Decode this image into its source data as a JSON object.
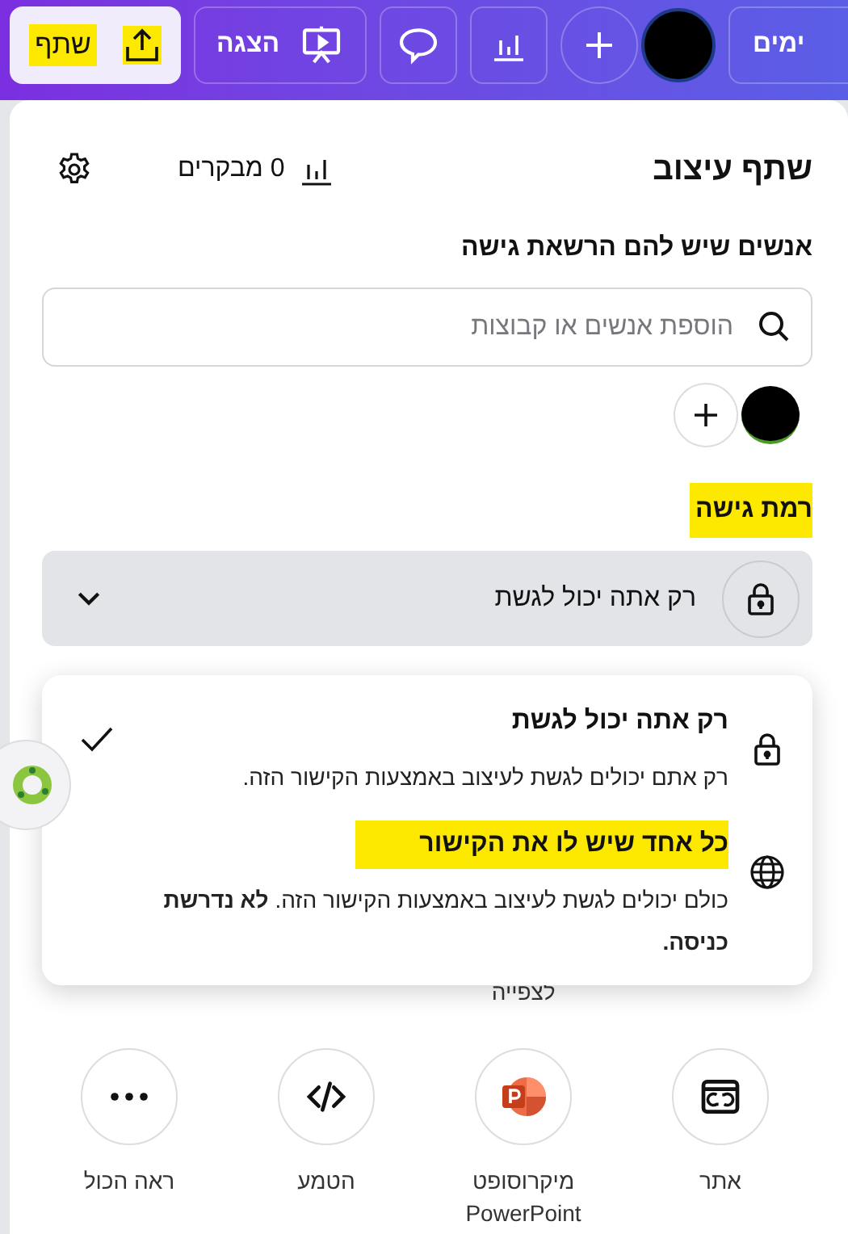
{
  "top_bar": {
    "share_button": {
      "label": "שתף",
      "highlighted": true
    },
    "present_button": {
      "label": "הצגה"
    },
    "days_button": {
      "label": "ימים"
    }
  },
  "panel": {
    "title": "שתף עיצוב",
    "visitors": "0 מבקרים"
  },
  "people": {
    "heading": "אנשים שיש להם הרשאת גישה",
    "search": {
      "placeholder": "הוספת אנשים או קבוצות"
    }
  },
  "access": {
    "heading": "רמת גישה",
    "highlighted": true,
    "current": "רק אתה יכול לגשת",
    "options": [
      {
        "kind": "private",
        "title": "רק אתה יכול לגשת",
        "description": "רק אתם יכולים לגשת לעיצוב באמצעות הקישור הזה.",
        "selected": true,
        "highlighted": false
      },
      {
        "kind": "public",
        "title": "כל אחד שיש לו את הקישור",
        "description": "כולם יכולים לגשת לעיצוב באמצעות הקישור הזה. **לא נדרשת כניסה.**",
        "selected": false,
        "highlighted": true
      }
    ]
  },
  "covered_row_text": "לצפייה",
  "share_targets": [
    {
      "kind": "website",
      "label": "אתר"
    },
    {
      "kind": "powerpoint",
      "label": "מיקרוסופט PowerPoint"
    },
    {
      "kind": "embed",
      "label": "הטמע"
    },
    {
      "kind": "more",
      "label": "ראה הכול"
    }
  ]
}
